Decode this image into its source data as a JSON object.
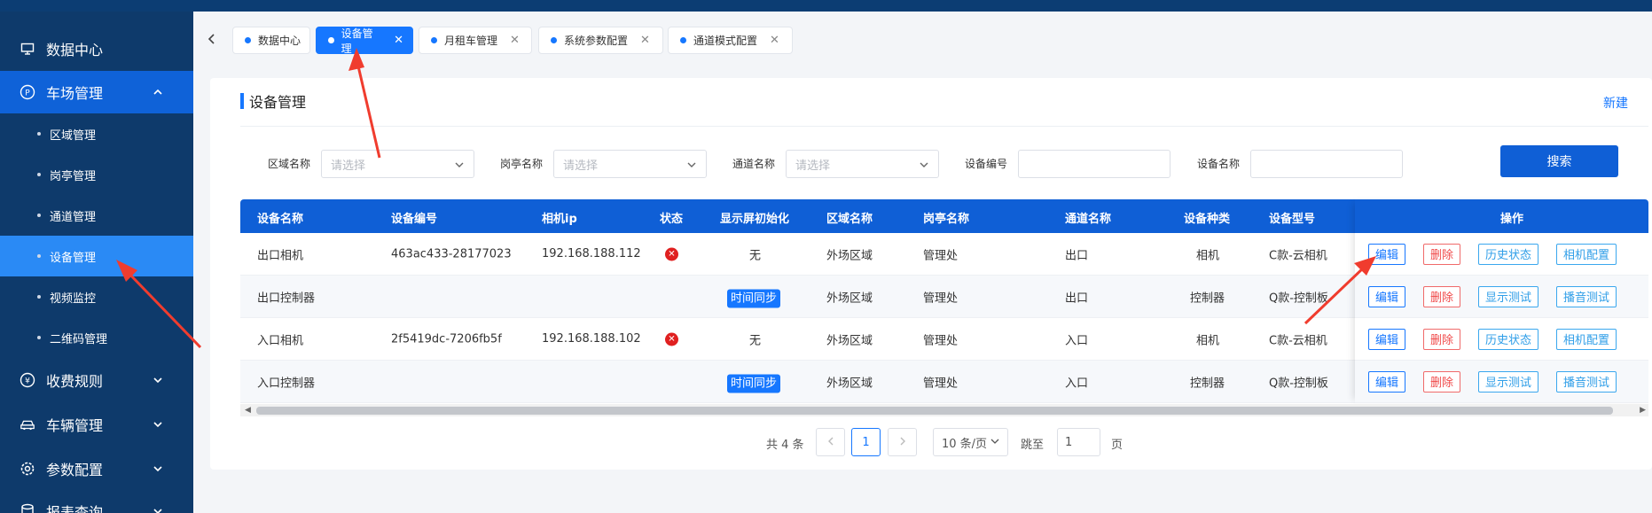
{
  "sidebar": {
    "items": [
      {
        "label": "数据中心",
        "icon": "monitor-icon"
      },
      {
        "label": "车场管理",
        "icon": "parking-icon"
      },
      {
        "label": "收费规则",
        "icon": "yen-icon"
      },
      {
        "label": "车辆管理",
        "icon": "car-icon"
      },
      {
        "label": "参数配置",
        "icon": "gear-icon"
      },
      {
        "label": "报表查询",
        "icon": "database-icon"
      }
    ],
    "sub_items": [
      "区域管理",
      "岗亭管理",
      "通道管理",
      "设备管理",
      "视频监控",
      "二维码管理"
    ],
    "active_sub": "设备管理"
  },
  "tabs": [
    {
      "label": "数据中心",
      "closable": false
    },
    {
      "label": "设备管理",
      "closable": true
    },
    {
      "label": "月租车管理",
      "closable": true
    },
    {
      "label": "系统参数配置",
      "closable": true
    },
    {
      "label": "通道模式配置",
      "closable": true
    }
  ],
  "tab_close_glyph": "✕",
  "page": {
    "title": "设备管理",
    "new_label": "新建"
  },
  "filters": {
    "area_label": "区域名称",
    "area_placeholder": "请选择",
    "booth_label": "岗亭名称",
    "booth_placeholder": "请选择",
    "channel_label": "通道名称",
    "channel_placeholder": "请选择",
    "device_no_label": "设备编号",
    "device_name_label": "设备名称",
    "search_label": "搜索"
  },
  "table": {
    "headers": [
      "设备名称",
      "设备编号",
      "相机ip",
      "状态",
      "显示屏初始化",
      "区域名称",
      "岗亭名称",
      "通道名称",
      "设备种类",
      "设备型号",
      "操作"
    ],
    "status_glyph": "✕",
    "rows": [
      {
        "name": "出口相机",
        "no": "463ac433-28177023",
        "ip": "192.168.188.112",
        "status": "offline",
        "init": "无",
        "area": "外场区域",
        "booth": "管理处",
        "channel": "出口",
        "kind": "相机",
        "model": "C款-云相机",
        "ops": [
          "编辑",
          "删除",
          "历史状态",
          "相机配置"
        ]
      },
      {
        "name": "出口控制器",
        "no": "",
        "ip": "",
        "status": "",
        "init": "时间同步",
        "area": "外场区域",
        "booth": "管理处",
        "channel": "出口",
        "kind": "控制器",
        "model": "Q款-控制板",
        "ops": [
          "编辑",
          "删除",
          "显示测试",
          "播音测试"
        ]
      },
      {
        "name": "入口相机",
        "no": "2f5419dc-7206fb5f",
        "ip": "192.168.188.102",
        "status": "offline",
        "init": "无",
        "area": "外场区域",
        "booth": "管理处",
        "channel": "入口",
        "kind": "相机",
        "model": "C款-云相机",
        "ops": [
          "编辑",
          "删除",
          "历史状态",
          "相机配置"
        ]
      },
      {
        "name": "入口控制器",
        "no": "",
        "ip": "",
        "status": "",
        "init": "时间同步",
        "area": "外场区域",
        "booth": "管理处",
        "channel": "入口",
        "kind": "控制器",
        "model": "Q款-控制板",
        "ops": [
          "编辑",
          "删除",
          "显示测试",
          "播音测试"
        ]
      }
    ]
  },
  "pagination": {
    "total": "共 4 条",
    "current": "1",
    "page_size": "10 条/页",
    "jump_label": "跳至",
    "jump_value": "1",
    "page_suffix": "页"
  },
  "colors": {
    "sidebar_bg": "#0e3a6b",
    "accent": "#1677ff",
    "header_blue": "#0f5fd6",
    "danger": "#e02020",
    "annotation": "#f03c2e"
  }
}
